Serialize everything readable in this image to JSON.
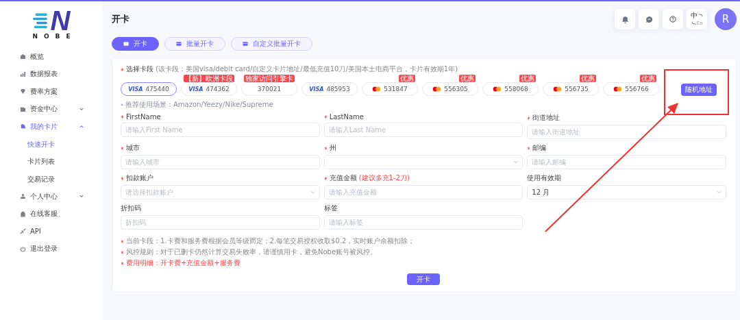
{
  "logo": {
    "mark": "N",
    "wordmark": "NOBE"
  },
  "sidebar": {
    "items": [
      {
        "label": "概览",
        "selected": false
      },
      {
        "label": "数据报表",
        "selected": false
      },
      {
        "label": "费率方案",
        "selected": false
      },
      {
        "label": "资金中心",
        "selected": false,
        "expanded": false
      },
      {
        "label": "我的卡片",
        "selected": false,
        "expanded": true,
        "children": [
          {
            "label": "快速开卡",
            "selected": true
          },
          {
            "label": "卡片列表",
            "selected": false
          },
          {
            "label": "交易记录",
            "selected": false
          }
        ]
      },
      {
        "label": "个人中心",
        "selected": false,
        "expanded": false
      },
      {
        "label": "在线客服",
        "selected": false
      },
      {
        "label": "API",
        "selected": false
      },
      {
        "label": "退出登录",
        "selected": false
      }
    ]
  },
  "page_title": "开卡",
  "header": {
    "lang": {
      "primary": "中",
      "secondary": "En"
    },
    "avatar": "R"
  },
  "tabs": [
    {
      "label": "开卡",
      "selected": true
    },
    {
      "label": "批量开卡",
      "selected": false
    },
    {
      "label": "自定义批量开卡",
      "selected": false
    }
  ],
  "card_segment": {
    "label": "选择卡段",
    "required": true,
    "hint": "(该卡段：美国visa/debit card/自定义卡片地址/最低充值10刀/美国本土电商平台，卡片有效期1年)",
    "options": [
      {
        "kind": "visa",
        "brand": "VISA",
        "number": "475440",
        "selected": true
      },
      {
        "kind": "visa",
        "brand": "VISA",
        "number": "474362",
        "badge": "【新】欧洲卡段",
        "selected": false
      },
      {
        "kind": "plain",
        "number": "370021",
        "badge": "独家访问引擎卡",
        "selected": false
      },
      {
        "kind": "visa",
        "brand": "VISA",
        "number": "485953",
        "selected": false
      },
      {
        "kind": "mastercard",
        "number": "531847",
        "badge": "优惠",
        "selected": false
      },
      {
        "kind": "mastercard",
        "number": "556305",
        "badge": "优惠",
        "selected": false
      },
      {
        "kind": "mastercard",
        "number": "558068",
        "badge": "优惠",
        "selected": false
      },
      {
        "kind": "mastercard",
        "number": "556735",
        "badge": "优惠",
        "selected": false
      },
      {
        "kind": "mastercard",
        "number": "556766",
        "badge": "优惠",
        "selected": false
      }
    ],
    "random_address_button": "随机地址",
    "recommended": "推荐使用场景：Amazon/Yeezy/Nike/Supreme"
  },
  "fields": [
    {
      "kind": "input",
      "label": "FirstName",
      "required": true,
      "placeholder": "请输入First Name"
    },
    {
      "kind": "input",
      "label": "LastName",
      "required": true,
      "placeholder": "请输入Last Name"
    },
    {
      "kind": "input",
      "label": "街道地址",
      "required": true,
      "placeholder": "请输入街道地址"
    },
    {
      "kind": "input",
      "label": "城市",
      "required": true,
      "placeholder": "请输入城市"
    },
    {
      "kind": "select",
      "label": "州",
      "required": true
    },
    {
      "kind": "input",
      "label": "邮编",
      "required": true,
      "placeholder": "请输入邮编"
    },
    {
      "kind": "select",
      "label": "扣款账户",
      "required": true,
      "placeholder": "请选择扣款账户"
    },
    {
      "kind": "input",
      "label": "充值金额",
      "required": true,
      "hint": "(建议多充1-2刀)",
      "placeholder": "请输入充值金额"
    },
    {
      "kind": "select",
      "label": "使用有效期",
      "required": false,
      "value": "12 月"
    },
    {
      "kind": "input",
      "label": "折扣码",
      "required": false,
      "placeholder": "折扣码"
    },
    {
      "kind": "input",
      "label": "标签",
      "required": false,
      "placeholder": "请输入标签"
    }
  ],
  "notes": [
    {
      "kind": "info",
      "text": "当前卡段：1.卡费和服务费根据会员等级而定；2.每笔交易授权收取$0.2，实时账户余额扣除；"
    },
    {
      "kind": "info",
      "text": "风控规则：对于已删卡仍然计算交易失败率，请谨慎用卡，避免Nobe账号被风控。"
    },
    {
      "kind": "fee",
      "text": "费用明细：开卡费+充值金额+服务费"
    }
  ],
  "submit_button": "开卡"
}
